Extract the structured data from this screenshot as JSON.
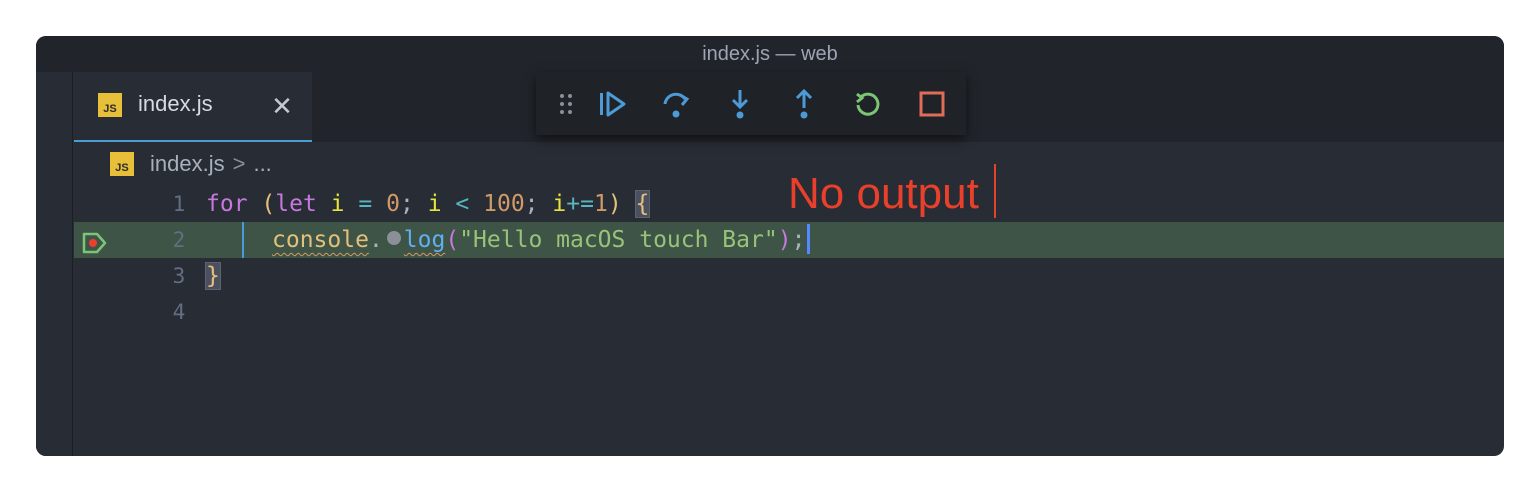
{
  "window": {
    "title": "index.js — web"
  },
  "tabs": [
    {
      "label": "index.js",
      "icon": "js-file-icon",
      "badge": "JS"
    }
  ],
  "breadcrumb": {
    "file": "index.js",
    "badge": "JS",
    "separator": ">",
    "more": "..."
  },
  "debug_toolbar": {
    "buttons": [
      {
        "name": "drag-handle",
        "icon": "gripper-icon",
        "color": "#8a8f98"
      },
      {
        "name": "continue",
        "icon": "continue-icon",
        "color": "#4d9bd6"
      },
      {
        "name": "step-over",
        "icon": "step-over-icon",
        "color": "#4d9bd6"
      },
      {
        "name": "step-into",
        "icon": "step-into-icon",
        "color": "#4d9bd6"
      },
      {
        "name": "step-out",
        "icon": "step-out-icon",
        "color": "#4d9bd6"
      },
      {
        "name": "restart",
        "icon": "restart-icon",
        "color": "#7cc576"
      },
      {
        "name": "stop",
        "icon": "stop-icon",
        "color": "#e06c5a"
      }
    ]
  },
  "editor": {
    "lines": [
      {
        "number": "1",
        "tokens": {
          "for": "for",
          "open_paren": "(",
          "let": "let",
          "i1": "i",
          "eq": "=",
          "zero": "0",
          "semi1": ";",
          "i2": "i",
          "lt": "<",
          "hundred": "100",
          "semi2": ";",
          "i3": "i",
          "pluseq": "+=",
          "one": "1",
          "close_paren": ")",
          "brace": "{"
        }
      },
      {
        "number": "2",
        "tokens": {
          "console": "console",
          "dot": ".",
          "log": "log",
          "open_paren": "(",
          "string": "\"Hello macOS touch Bar\"",
          "close_paren": ")",
          "semi": ";"
        },
        "current": true,
        "breakpoint": true
      },
      {
        "number": "3",
        "tokens": {
          "brace": "}"
        }
      },
      {
        "number": "4",
        "tokens": {}
      }
    ]
  },
  "annotation": {
    "text": "No output",
    "color": "#e8402b"
  },
  "colors": {
    "accent": "#4d9bd6",
    "current_line": "#3d5446",
    "breakpoint": "#e8402b"
  }
}
